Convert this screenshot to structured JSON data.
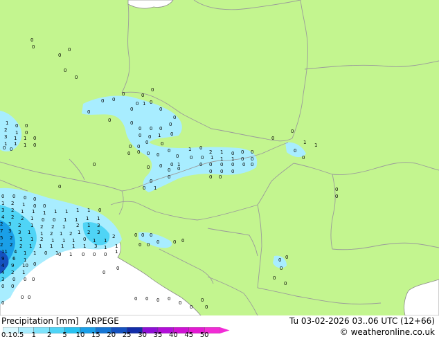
{
  "header": {
    "product_label": "Precipitation [mm]",
    "model_label": "ARPEGE",
    "datetime_label": "Tu 03-02-2026 03..06 UTC (12+66)",
    "credit": "© weatheronline.co.uk"
  },
  "legend": {
    "ticks": [
      "0.1",
      "0.5",
      "1",
      "2",
      "5",
      "10",
      "15",
      "20",
      "25",
      "30",
      "35",
      "40",
      "45",
      "50"
    ],
    "colors": [
      "#d7f8ff",
      "#a8edff",
      "#7fe3fb",
      "#4fd4f6",
      "#29c2f0",
      "#1a9fe8",
      "#1676d4",
      "#1552c0",
      "#132da8",
      "#8e0fd6",
      "#b20fd8",
      "#cf12d4",
      "#e31ad2",
      "#f22bd6"
    ]
  },
  "map": {
    "land_color": "#c3f58f",
    "border_color": "#9a9a9a",
    "coast_color": "#8a8a8a",
    "precip_light_color": "#a8edff",
    "precip_mid_color": "#4fd4f6",
    "precip_heavy_color": "#1a9fe8",
    "precip_max_color": "#1552c0"
  }
}
